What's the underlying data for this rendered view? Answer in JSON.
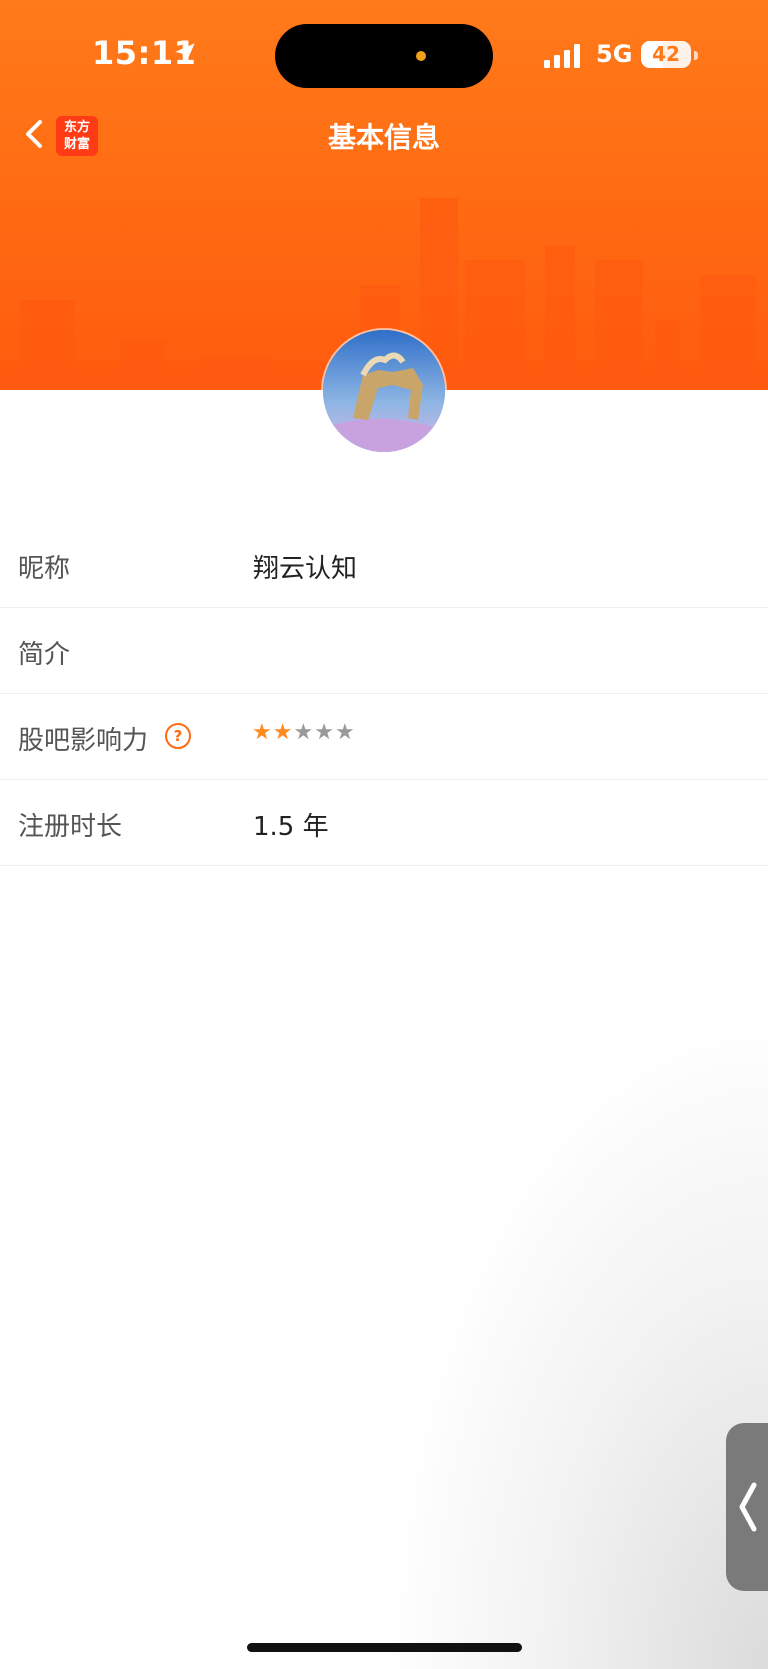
{
  "status_bar": {
    "time": "15:11",
    "network": "5G",
    "battery": "42"
  },
  "header": {
    "title": "基本信息",
    "brand_line1": "东方",
    "brand_line2": "财富"
  },
  "profile": {
    "rows": [
      {
        "label": "昵称",
        "value": "翔云认知"
      },
      {
        "label": "简介",
        "value": ""
      },
      {
        "label": "股吧影响力",
        "stars_filled": 2,
        "stars_total": 5
      },
      {
        "label": "注册时长",
        "value": "1.5 年"
      }
    ]
  },
  "icons": [
    "location-arrow-icon",
    "signal-icon",
    "battery-icon",
    "back-icon",
    "help-icon",
    "star-icon",
    "chevron-left-icon"
  ],
  "colors": {
    "accent": "#ff6a12",
    "star_on": "#ff8a1f",
    "star_off": "#9a9a9a"
  }
}
